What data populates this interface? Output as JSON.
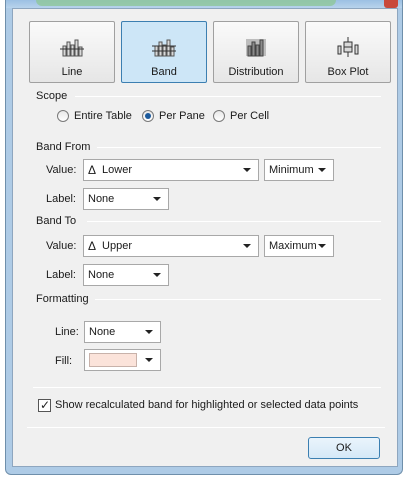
{
  "types": [
    {
      "label": "Line",
      "icon": "line-chart-icon",
      "selected": false
    },
    {
      "label": "Band",
      "icon": "band-chart-icon",
      "selected": true
    },
    {
      "label": "Distribution",
      "icon": "distribution-chart-icon",
      "selected": false
    },
    {
      "label": "Box Plot",
      "icon": "box-plot-icon",
      "selected": false
    }
  ],
  "scope": {
    "title": "Scope",
    "options": [
      "Entire Table",
      "Per Pane",
      "Per Cell"
    ],
    "selected": "Per Pane"
  },
  "band_from": {
    "title": "Band From",
    "value_label": "Value:",
    "value_symbol": "Δ",
    "value": "Lower",
    "aggregation": "Minimum",
    "label_label": "Label:",
    "label_value": "None"
  },
  "band_to": {
    "title": "Band To",
    "value_label": "Value:",
    "value_symbol": "Δ",
    "value": "Upper",
    "aggregation": "Maximum",
    "label_label": "Label:",
    "label_value": "None"
  },
  "formatting": {
    "title": "Formatting",
    "line_label": "Line:",
    "line_value": "None",
    "fill_label": "Fill:",
    "fill_color": "#fbe3da"
  },
  "show_recalculated": {
    "checked": true,
    "label": "Show recalculated band for highlighted or selected data points"
  },
  "ok_label": "OK"
}
